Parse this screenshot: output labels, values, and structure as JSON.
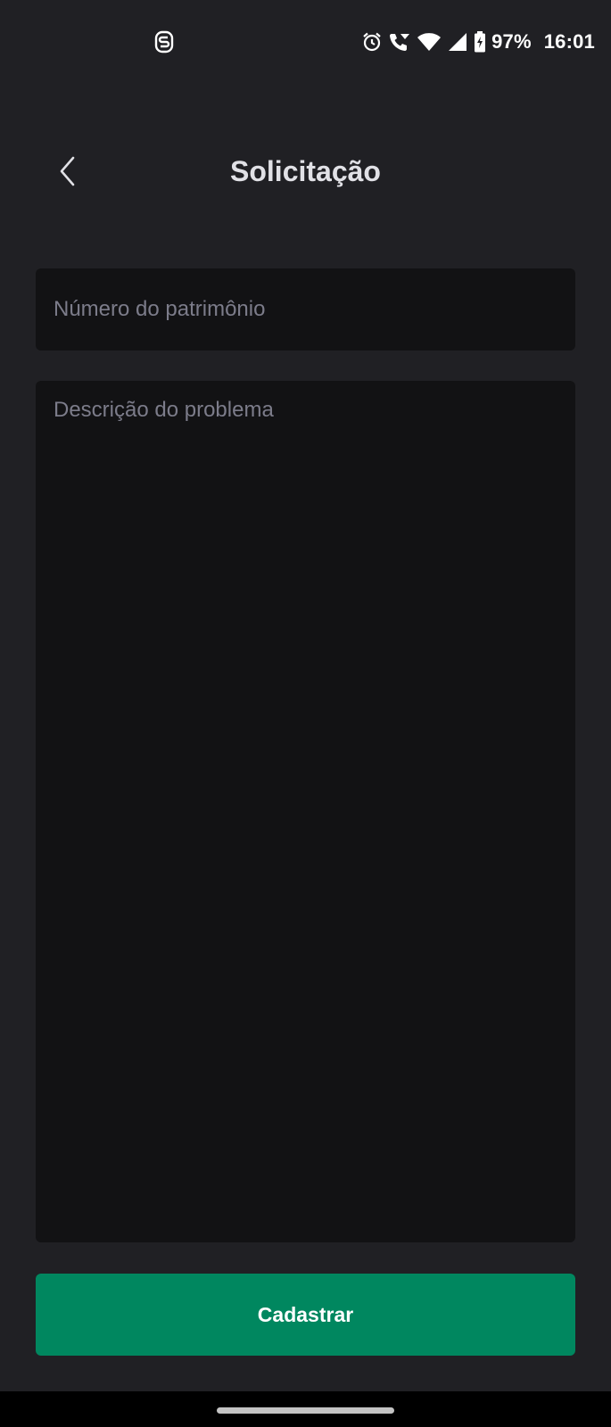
{
  "status_bar": {
    "left_icon": "notification-s-icon",
    "icons": [
      "alarm-icon",
      "wifi-call-icon",
      "wifi-icon",
      "signal-icon",
      "battery-charging-icon"
    ],
    "battery": "97%",
    "time": "16:01"
  },
  "header": {
    "title": "Solicitação",
    "back_icon": "chevron-left-icon"
  },
  "form": {
    "patrimony_placeholder": "Número do patrimônio",
    "patrimony_value": "",
    "description_placeholder": "Descrição do problema",
    "description_value": "",
    "submit_label": "Cadastrar"
  },
  "colors": {
    "background": "#202024",
    "field_background": "#121214",
    "placeholder": "#7c7c8a",
    "title": "#e1e1e6",
    "accent": "#00875f"
  }
}
